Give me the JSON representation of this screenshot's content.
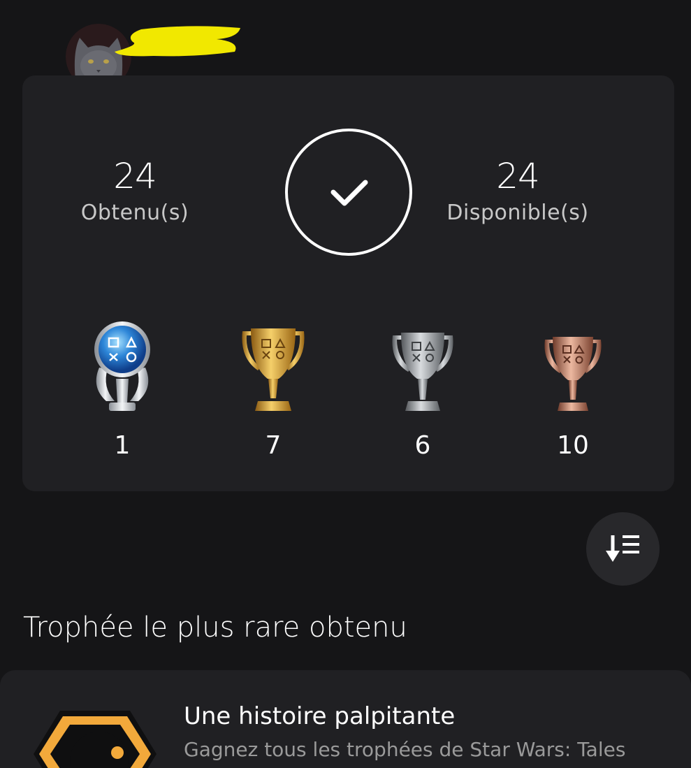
{
  "profile": {
    "avatar_icon": "cat-avatar",
    "username_redacted": true
  },
  "summary": {
    "earned_count": "24",
    "earned_label": "Obtenu(s)",
    "available_count": "24",
    "available_label": "Disponible(s)",
    "completion_percent": 100,
    "completion_icon": "checkmark-icon"
  },
  "trophies": {
    "platinum": {
      "icon": "platinum-trophy-icon",
      "count": "1",
      "color": "#4aa8f0"
    },
    "gold": {
      "icon": "gold-trophy-icon",
      "count": "7",
      "color": "#d9a43a"
    },
    "silver": {
      "icon": "silver-trophy-icon",
      "count": "6",
      "color": "#b8b8b8"
    },
    "bronze": {
      "icon": "bronze-trophy-icon",
      "count": "10",
      "color": "#c98a73"
    }
  },
  "sort": {
    "icon": "sort-descending-icon"
  },
  "rarest": {
    "section_title": "Trophée le plus rare obtenu",
    "trophy_name": "Une histoire palpitante",
    "trophy_description": "Gagnez tous les trophées de Star Wars: Tales",
    "icon": "trophy-badge-icon",
    "accent_color": "#f2a93b"
  },
  "theme": {
    "background": "#151517",
    "card": "#202023",
    "text_secondary": "#c8c8c8"
  }
}
